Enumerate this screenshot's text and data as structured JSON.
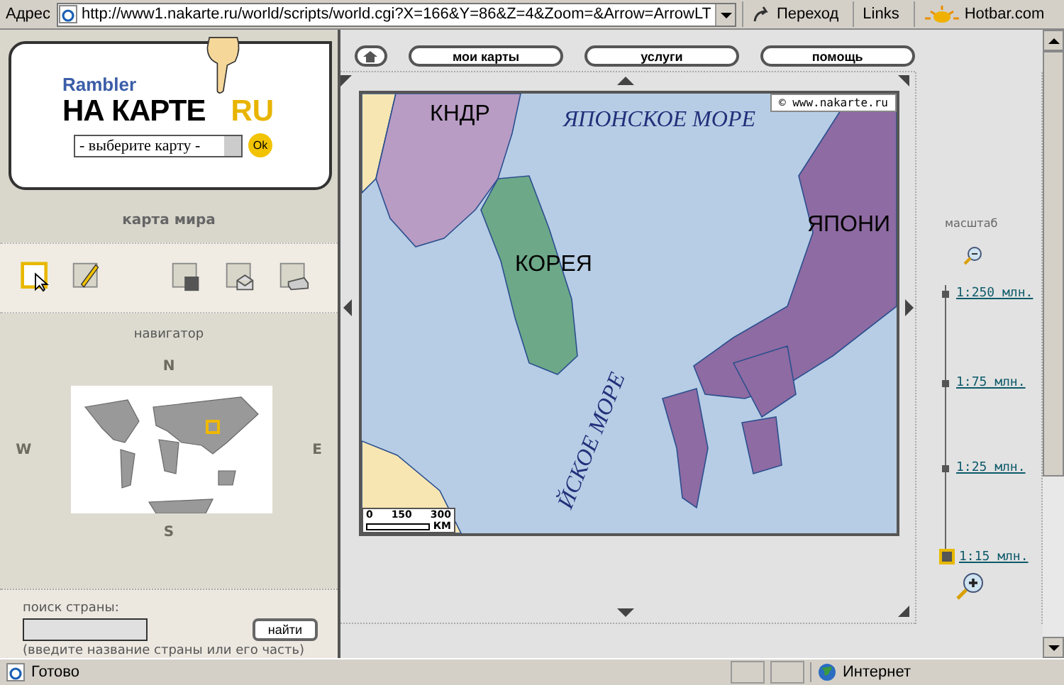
{
  "address_bar": {
    "label": "Адрес",
    "url": "http://www1.nakarte.ru/world/scripts/world.cgi?X=166&Y=86&Z=4&Zoom=&Arrow=ArrowLT",
    "go": "Переход",
    "links": "Links",
    "hotbar": "Hotbar.com"
  },
  "logo": {
    "brand": "Rambler",
    "title": "НА КАРТЕ",
    "suffix": "RU"
  },
  "map_select": {
    "value": "- выберите карту -",
    "ok": "Ok"
  },
  "nav_buttons": [
    "мои карты",
    "услуги",
    "помощь"
  ],
  "world_map_title": "карта мира",
  "tools": [
    {
      "kind": "pointer",
      "selected": true
    },
    {
      "kind": "pencil",
      "selected": false
    },
    {
      "kind": "save",
      "selected": false
    },
    {
      "kind": "mail",
      "selected": false
    },
    {
      "kind": "print",
      "selected": false
    }
  ],
  "navigator": {
    "title": "навигатор",
    "north": "N",
    "west": "W",
    "east": "E",
    "south": "S"
  },
  "search": {
    "label": "поиск страны:",
    "button": "найти",
    "hint": "(введите название страны или его часть)"
  },
  "map": {
    "copyright": "© www.nakarte.ru",
    "labels": [
      {
        "text": "КНДР",
        "kind": "country"
      },
      {
        "text": "ЯПОНСКОЕ МОРЕ",
        "kind": "sea"
      },
      {
        "text": "КОРЕЯ",
        "kind": "country"
      },
      {
        "text": "ЯПОНИ",
        "kind": "country"
      },
      {
        "text": "ЙСКОЕ МОРЕ",
        "kind": "sea"
      }
    ],
    "scale_ticks": [
      "0",
      "150",
      "300"
    ],
    "scale_unit": "КМ"
  },
  "scale": {
    "title": "масштаб",
    "levels": [
      {
        "label": "1:250 млн.",
        "selected": false
      },
      {
        "label": "1:75 млн.",
        "selected": false
      },
      {
        "label": "1:25 млн.",
        "selected": false
      },
      {
        "label": "1:15 млн.",
        "selected": true
      }
    ]
  },
  "status_bar": {
    "text": "Готово",
    "zone": "Интернет"
  }
}
